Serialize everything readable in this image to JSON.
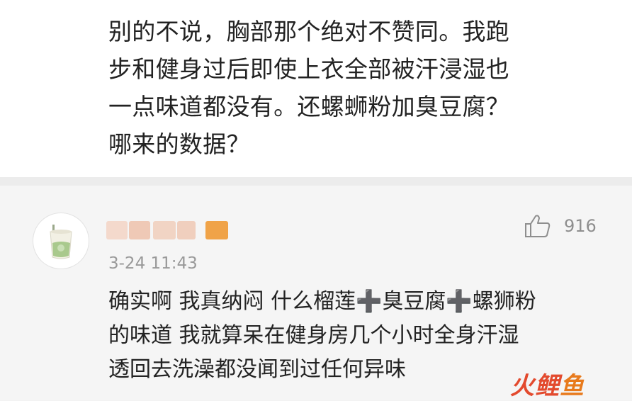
{
  "post": {
    "lines": [
      "别的不说，胸部那个绝对不赞同。我跑",
      "步和健身过后即使上衣全部被汗浸湿也",
      "一点味道都没有。还螺蛳粉加臭豆腐？",
      "哪来的数据？"
    ]
  },
  "comment": {
    "avatar_icon": "milk-tea-cup-icon",
    "username_censored": true,
    "timestamp": "3-24 11:43",
    "like_icon": "thumbs-up-icon",
    "like_count": "916",
    "lines": [
      "确实啊 我真纳闷 什么榴莲➕臭豆腐➕螺狮粉",
      "的味道 我就算呆在健身房几个小时全身汗湿",
      "透回去洗澡都没闻到过任何异味"
    ]
  },
  "watermark": {
    "chars": [
      "火",
      "鲤",
      "鱼"
    ]
  },
  "colors": {
    "text": "#222222",
    "muted": "#999999",
    "watermark_red": "#e34a2e",
    "watermark_orange": "#e87a1c"
  }
}
